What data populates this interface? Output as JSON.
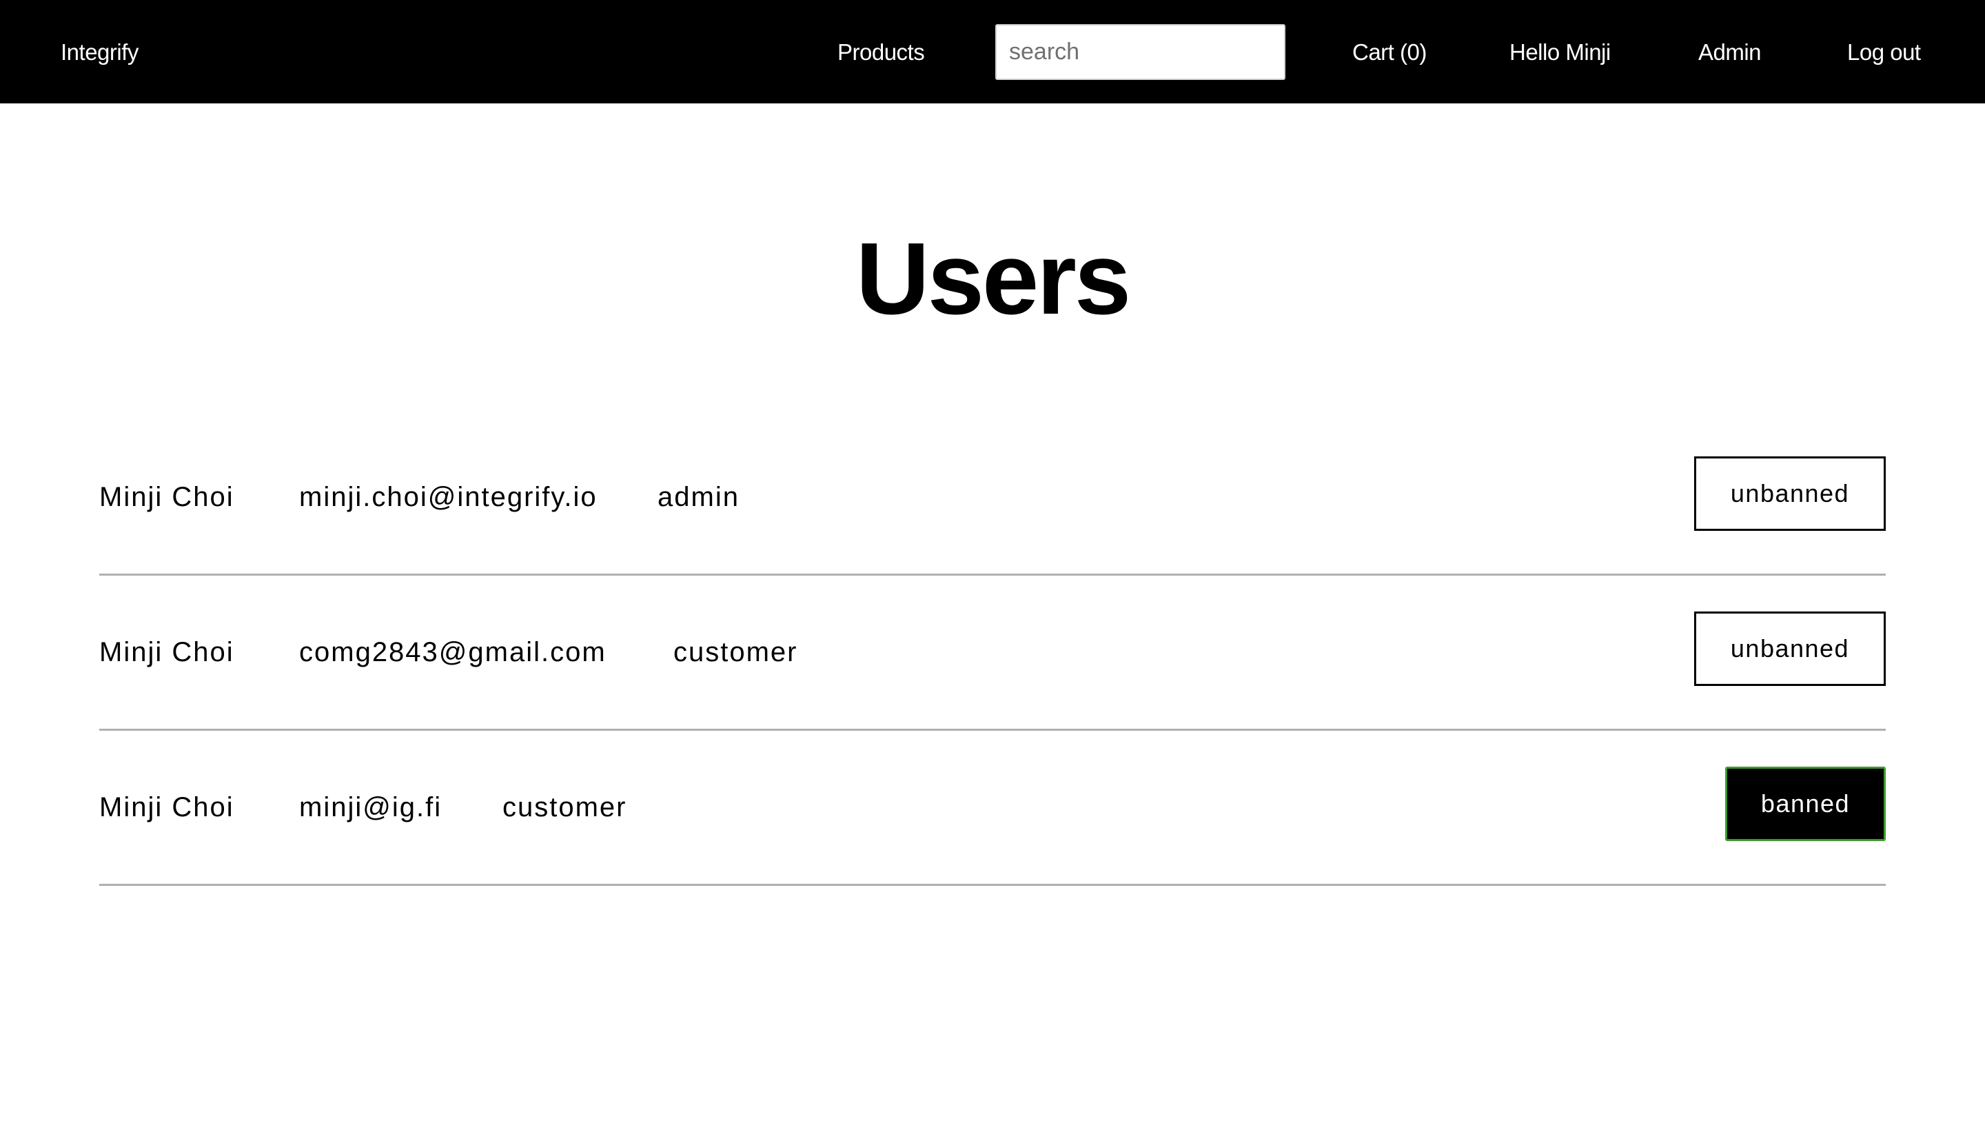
{
  "header": {
    "brand": "Integrify",
    "nav": {
      "products": "Products",
      "cart": "Cart (0)",
      "greeting": "Hello Minji",
      "admin": "Admin",
      "logout": "Log out"
    },
    "search": {
      "placeholder": "search",
      "value": ""
    }
  },
  "main": {
    "title": "Users",
    "users": [
      {
        "name": "Minji Choi",
        "email": "minji.choi@integrify.io",
        "role": "admin",
        "status": "unbanned"
      },
      {
        "name": "Minji Choi",
        "email": "comg2843@gmail.com",
        "role": "customer",
        "status": "unbanned"
      },
      {
        "name": "Minji Choi",
        "email": "minji@ig.fi",
        "role": "customer",
        "status": "banned"
      }
    ]
  },
  "colors": {
    "header_bg": "#000000",
    "header_text": "#ffffff",
    "banned_bg": "#000000",
    "banned_border": "#3f9a2e",
    "divider": "#b0b0b0"
  }
}
